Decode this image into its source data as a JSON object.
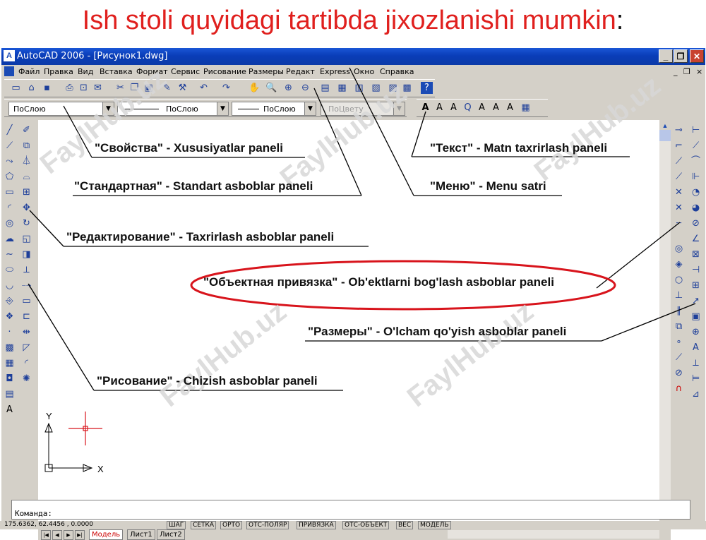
{
  "slide_title": {
    "text": "Ish stoli quyidagi tartibda jixozlanishi mumkin",
    "colon": ":"
  },
  "window": {
    "title": "AutoCAD 2006 - [Рисунок1.dwg]",
    "app_icon": "autocad-icon",
    "controls": {
      "minimize": "_",
      "maximize": "❐",
      "close": "✕"
    }
  },
  "menu": {
    "items": [
      "Файл",
      "Правка",
      "Вид",
      "Вставка",
      "Формат",
      "Сервис",
      "Рисование",
      "Размеры",
      "Редакт",
      "Express",
      "Окно",
      "Справка"
    ],
    "doc_controls": {
      "minimize": "_",
      "restore": "❐",
      "close": "×"
    }
  },
  "properties": {
    "layer": "ПоСлою",
    "linetype": "ПоСлою",
    "lineweight": "ПоСлою",
    "plotstyle": "ПоЦвету"
  },
  "ucs": {
    "x_label": "X",
    "y_label": "Y"
  },
  "tabs": {
    "items": [
      "Модель",
      "Лист1",
      "Лист2"
    ],
    "active": "Модель"
  },
  "command": {
    "prompt": "Команда:"
  },
  "status": {
    "coords": "175.6362, 62.4456 , 0.0000",
    "buttons": [
      "ШАГ",
      "СЕТКА",
      "ОРТО",
      "ОТС-ПОЛЯР",
      "ПРИВЯЗКА",
      "ОТС-ОБЪЕКТ",
      "ВЕС",
      "МОДЕЛЬ"
    ]
  },
  "callouts": {
    "svoystva": "\"Свойства\" - Xususiyatlar paneli",
    "standartnaya": "\"Стандартная\" - Standart asboblar  paneli",
    "redaktirovanie": "\"Редактирование\" - Taxrirlash asboblar paneli",
    "obektnaya": "\"Объектная привязка\" - Ob'ektlarni bog'lash asboblar paneli",
    "tekst": "\"Текст\" - Matn taxrirlash paneli",
    "menyu": "\"Меню\" - Menu satri",
    "razmery": "\"Размеры\" - O'lcham qo'yish asboblar paneli",
    "risovanie": "\"Рисование\" - Chizish asboblar paneli"
  },
  "watermark": "FaylHub.uz",
  "colors": {
    "title_red": "#e0201e",
    "ellipse_red": "#d8141c",
    "window_blue": "#0a3db8",
    "face": "#d4d0c8"
  }
}
